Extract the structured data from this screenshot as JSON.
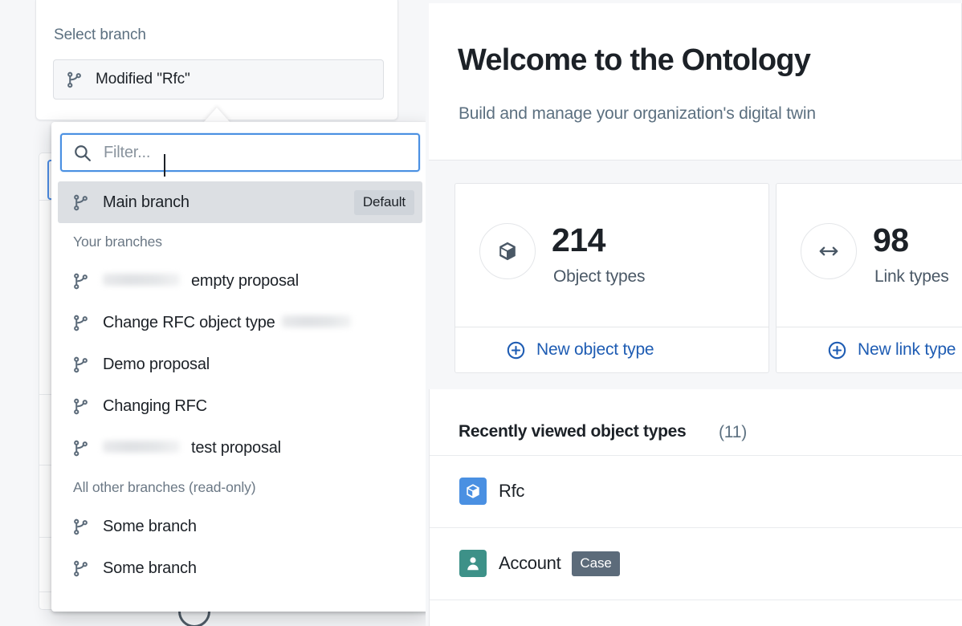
{
  "branch_selector": {
    "label": "Select branch",
    "current_branch": "Modified \"Rfc\"",
    "icon": "git-branch-icon"
  },
  "dropdown": {
    "filter_placeholder": "Filter...",
    "filter_value": "",
    "search_icon": "search-icon",
    "selected_option": {
      "label": "Main branch",
      "badge": "Default",
      "icon": "git-branch-icon"
    },
    "groups": [
      {
        "heading": "Your branches",
        "items": [
          {
            "label": "empty proposal",
            "redacted_prefix": true,
            "redacted_suffix": false
          },
          {
            "label": "Change RFC object type",
            "redacted_prefix": false,
            "redacted_suffix": true
          },
          {
            "label": "Demo proposal",
            "redacted_prefix": false,
            "redacted_suffix": false
          },
          {
            "label": "Changing RFC",
            "redacted_prefix": false,
            "redacted_suffix": false
          },
          {
            "label": "test proposal",
            "redacted_prefix": true,
            "redacted_suffix": false
          }
        ]
      },
      {
        "heading": "All other branches (read-only)",
        "items": [
          {
            "label": "Some branch",
            "redacted_prefix": false,
            "redacted_suffix": false
          },
          {
            "label": "Some branch",
            "redacted_prefix": false,
            "redacted_suffix": false
          }
        ]
      }
    ]
  },
  "hero": {
    "title": "Welcome to the Ontology",
    "subtitle": "Build and manage your organization's digital twin"
  },
  "stats": [
    {
      "value": "214",
      "label": "Object types",
      "icon": "cube-icon",
      "action_label": "New object type",
      "action_icon": "plus-circle-icon"
    },
    {
      "value": "98",
      "label": "Link types",
      "icon": "arrows-horizontal-icon",
      "action_label": "New link type",
      "action_icon": "plus-circle-icon"
    }
  ],
  "recent": {
    "title": "Recently viewed object types",
    "count": "(11)",
    "rows": [
      {
        "name": "Rfc",
        "icon": "cube-icon",
        "icon_color": "#4a90e2",
        "tag": ""
      },
      {
        "name": "Account",
        "icon": "person-icon",
        "icon_color": "#3d9188",
        "tag": "Case"
      }
    ]
  },
  "colors": {
    "accent_blue": "#1e5cb3",
    "focus_blue": "#4a90e2",
    "selected_gray": "#dcdfe3",
    "page_bg": "#f6f7f9"
  }
}
